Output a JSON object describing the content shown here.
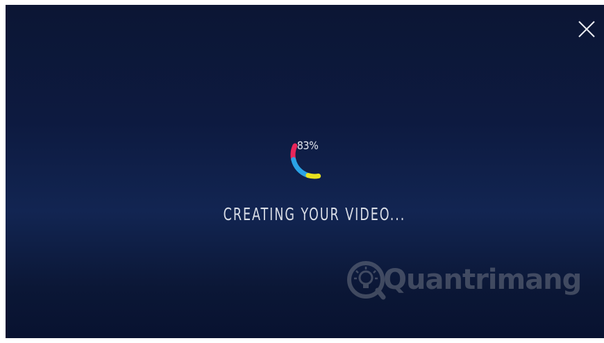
{
  "dialog": {
    "progress": {
      "label": "83%",
      "value": 0.83,
      "segment_colors": [
        "#e8265a",
        "#2aa3e6",
        "#e8e21f"
      ]
    },
    "status_text": "CREATING YOUR VIDEO...",
    "close_icon": "close-icon"
  },
  "watermark": {
    "text": "Quantrimang",
    "logo_icon": "lightbulb-icon"
  }
}
